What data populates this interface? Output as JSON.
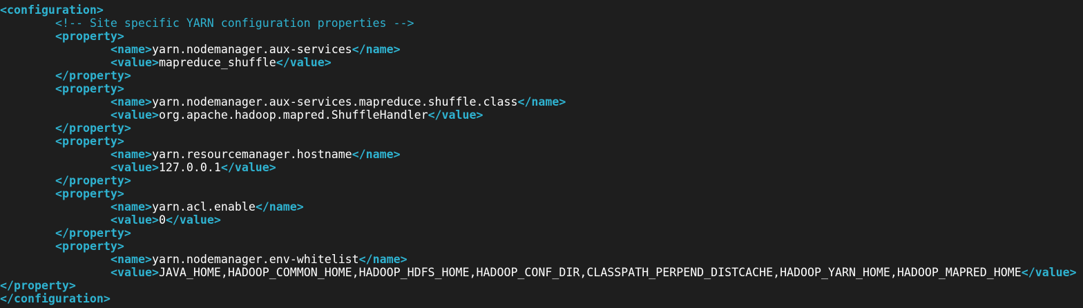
{
  "lines": [
    {
      "indent": 0,
      "parts": [
        {
          "t": "tag",
          "v": "<configuration>"
        }
      ]
    },
    {
      "indent": 1,
      "parts": [
        {
          "t": "comment",
          "v": "<!-- Site specific YARN configuration properties -->"
        }
      ]
    },
    {
      "indent": 1,
      "parts": [
        {
          "t": "tag",
          "v": "<property>"
        }
      ]
    },
    {
      "indent": 2,
      "parts": [
        {
          "t": "tag",
          "v": "<name>"
        },
        {
          "t": "text",
          "v": "yarn.nodemanager.aux-services"
        },
        {
          "t": "tag",
          "v": "</name>"
        }
      ]
    },
    {
      "indent": 2,
      "parts": [
        {
          "t": "tag",
          "v": "<value>"
        },
        {
          "t": "text",
          "v": "mapreduce_shuffle"
        },
        {
          "t": "tag",
          "v": "</value>"
        }
      ]
    },
    {
      "indent": 1,
      "parts": [
        {
          "t": "tag",
          "v": "</property>"
        }
      ]
    },
    {
      "indent": 1,
      "parts": [
        {
          "t": "tag",
          "v": "<property>"
        }
      ]
    },
    {
      "indent": 2,
      "parts": [
        {
          "t": "tag",
          "v": "<name>"
        },
        {
          "t": "text",
          "v": "yarn.nodemanager.aux-services.mapreduce.shuffle.class"
        },
        {
          "t": "tag",
          "v": "</name>"
        }
      ]
    },
    {
      "indent": 2,
      "parts": [
        {
          "t": "tag",
          "v": "<value>"
        },
        {
          "t": "text",
          "v": "org.apache.hadoop.mapred.ShuffleHandler"
        },
        {
          "t": "tag",
          "v": "</value>"
        }
      ]
    },
    {
      "indent": 1,
      "parts": [
        {
          "t": "tag",
          "v": "</property>"
        }
      ]
    },
    {
      "indent": 1,
      "parts": [
        {
          "t": "tag",
          "v": "<property>"
        }
      ]
    },
    {
      "indent": 2,
      "parts": [
        {
          "t": "tag",
          "v": "<name>"
        },
        {
          "t": "text",
          "v": "yarn.resourcemanager.hostname"
        },
        {
          "t": "tag",
          "v": "</name>"
        }
      ]
    },
    {
      "indent": 2,
      "parts": [
        {
          "t": "tag",
          "v": "<value>"
        },
        {
          "t": "text",
          "v": "127.0.0.1"
        },
        {
          "t": "tag",
          "v": "</value>"
        }
      ]
    },
    {
      "indent": 1,
      "parts": [
        {
          "t": "tag",
          "v": "</property>"
        }
      ]
    },
    {
      "indent": 1,
      "parts": [
        {
          "t": "tag",
          "v": "<property>"
        }
      ]
    },
    {
      "indent": 2,
      "parts": [
        {
          "t": "tag",
          "v": "<name>"
        },
        {
          "t": "text",
          "v": "yarn.acl.enable"
        },
        {
          "t": "tag",
          "v": "</name>"
        }
      ]
    },
    {
      "indent": 2,
      "parts": [
        {
          "t": "tag",
          "v": "<value>"
        },
        {
          "t": "text",
          "v": "0"
        },
        {
          "t": "tag",
          "v": "</value>"
        }
      ]
    },
    {
      "indent": 1,
      "parts": [
        {
          "t": "tag",
          "v": "</property>"
        }
      ]
    },
    {
      "indent": 1,
      "parts": [
        {
          "t": "tag",
          "v": "<property>"
        }
      ]
    },
    {
      "indent": 2,
      "parts": [
        {
          "t": "tag",
          "v": "<name>"
        },
        {
          "t": "text",
          "v": "yarn.nodemanager.env-whitelist"
        },
        {
          "t": "tag",
          "v": "</name>"
        }
      ]
    },
    {
      "indent": 2,
      "parts": [
        {
          "t": "tag",
          "v": "<value>"
        },
        {
          "t": "text",
          "v": "JAVA_HOME,HADOOP_COMMON_HOME,HADOOP_HDFS_HOME,HADOOP_CONF_DIR,CLASSPATH_PERPEND_DISTCACHE,HADOOP_YARN_HOME,HADOOP_MAPRED_HOME"
        },
        {
          "t": "tag",
          "v": "</value>"
        }
      ]
    },
    {
      "indent": 0,
      "parts": [
        {
          "t": "tag",
          "v": "</property>"
        }
      ]
    },
    {
      "indent": 0,
      "parts": [
        {
          "t": "tag",
          "v": "</configuration>"
        }
      ]
    }
  ],
  "colors": {
    "background": "#1e1e1e",
    "tag": "#2fb3d1",
    "text": "#ffffff"
  }
}
